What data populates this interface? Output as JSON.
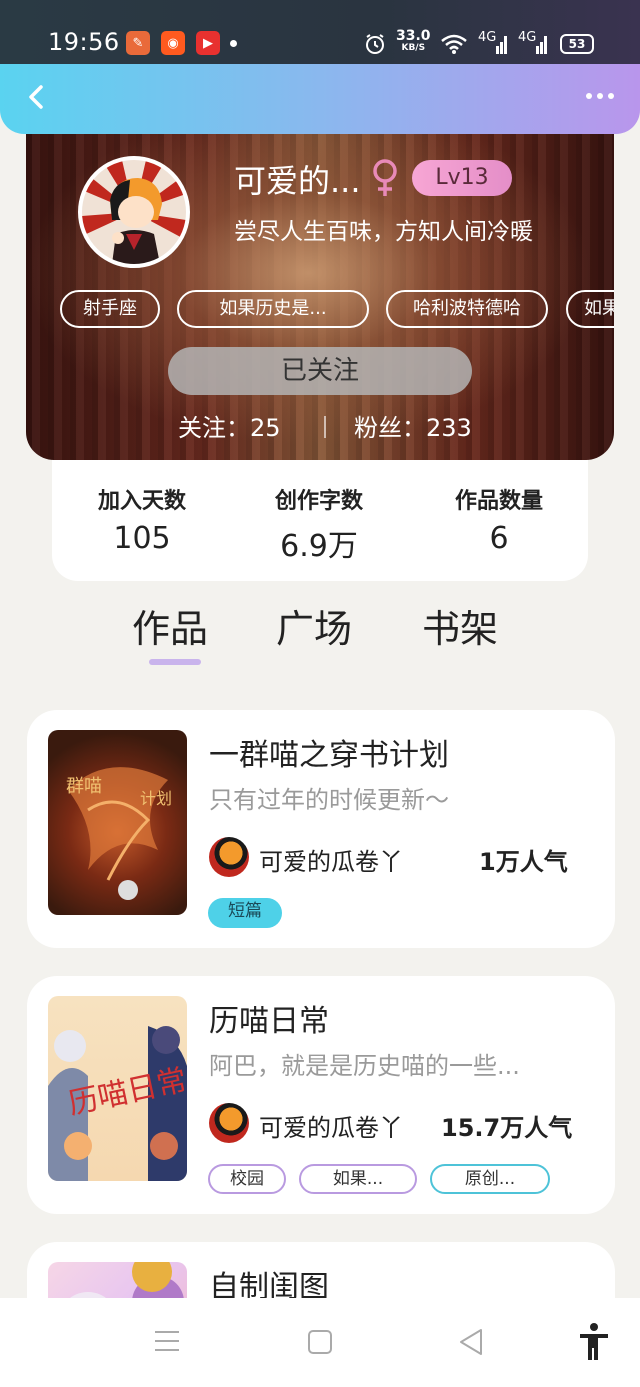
{
  "status_bar": {
    "time": "19:56",
    "net_speed": "33.0",
    "net_unit": "KB/S",
    "signal1": "4G",
    "signal2": "4G",
    "battery": "53",
    "apps": [
      "plan-app-icon",
      "kuaishou-icon",
      "video-app-icon"
    ]
  },
  "header": {
    "back_icon": "chevron-left-icon",
    "more_icon": "more-dots-icon",
    "colors": {
      "start": "#5ad3f0",
      "end": "#b996ec"
    }
  },
  "profile": {
    "nickname": "可爱的...",
    "gender_symbol": "♀",
    "level": "Lv13",
    "bio": "尝尽人生百味，方知人间冷暖",
    "tags": [
      "射手座",
      "如果历史是...",
      "哈利波特德哈",
      "如果"
    ],
    "follow_button": "已关注",
    "following_text": "关注：25",
    "followers_text": "粉丝：233"
  },
  "stats": [
    {
      "label": "加入天数",
      "value": "105"
    },
    {
      "label": "创作字数",
      "value": "6.9万"
    },
    {
      "label": "作品数量",
      "value": "6"
    }
  ],
  "tabs": [
    "作品",
    "广场",
    "书架"
  ],
  "works": [
    {
      "title": "一群喵之穿书计划",
      "desc": "只有过年的时候更新～",
      "author": "可爱的瓜卷丫",
      "popularity": "1万人气",
      "tags": [
        {
          "label": "短篇",
          "style": "filled-cyan"
        }
      ]
    },
    {
      "title": "历喵日常",
      "desc": "阿巴，就是是历史喵的一些...",
      "author": "可爱的瓜卷丫",
      "popularity": "15.7万人气",
      "tags": [
        {
          "label": "校园",
          "style": "outline-purple"
        },
        {
          "label": "如果...",
          "style": "outline-purple"
        },
        {
          "label": "原创...",
          "style": "outline-cyan"
        }
      ]
    },
    {
      "title": "自制闺图"
    }
  ],
  "nav": {
    "menu_icon": "menu-icon",
    "home_icon": "home-square-icon",
    "back_icon": "back-triangle-icon",
    "accessibility_icon": "accessibility-icon"
  }
}
